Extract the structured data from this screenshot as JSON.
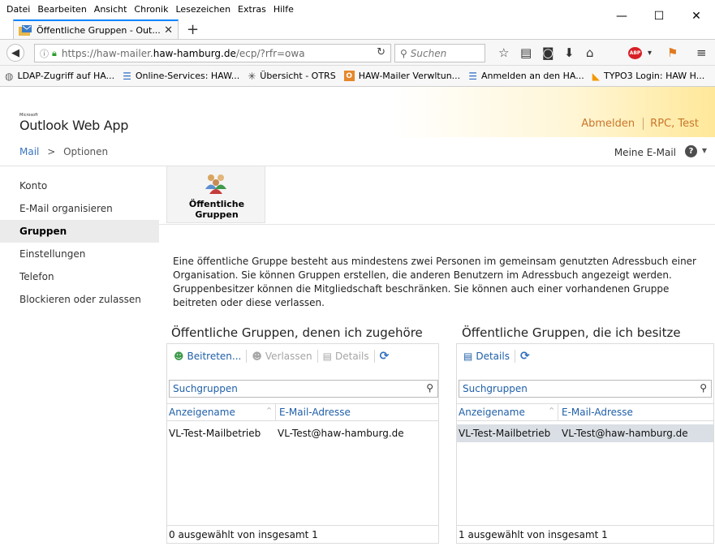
{
  "browser": {
    "menu": [
      "Datei",
      "Bearbeiten",
      "Ansicht",
      "Chronik",
      "Lesezeichen",
      "Extras",
      "Hilfe"
    ],
    "window_controls": {
      "minimize": "—",
      "maximize": "☐",
      "close": "✕"
    },
    "tab": {
      "title": "Öffentliche Gruppen - Out...",
      "close": "✕",
      "new_tab": "+"
    },
    "url": {
      "prefix": "https://haw-mailer.",
      "domain": "haw-hamburg.de",
      "path": "/ecp/?rfr=owa"
    },
    "search_placeholder": "Suchen",
    "bookmarks": [
      {
        "label": "LDAP-Zugriff auf HA...",
        "icon": "globe-icon"
      },
      {
        "label": "Online-Services: HAW...",
        "icon": "list-icon"
      },
      {
        "label": "Übersicht - OTRS",
        "icon": "otrs-icon"
      },
      {
        "label": "HAW-Mailer Verwltun...",
        "icon": "outlook-icon"
      },
      {
        "label": "Anmelden an den HA...",
        "icon": "list-icon"
      },
      {
        "label": "TYPO3 Login: HAW H...",
        "icon": "typo3-icon"
      }
    ],
    "colors": {
      "accent": "#0a84ff",
      "abp": "#d81f26"
    }
  },
  "owa": {
    "brand_small": "Microsoft",
    "title": "Outlook Web App",
    "signout": "Abmelden",
    "user": "RPC, Test",
    "breadcrumb": {
      "mail": "Mail",
      "separator": ">",
      "current": "Optionen"
    },
    "my_mail": "Meine E-Mail",
    "help": "?",
    "nav": [
      "Konto",
      "E-Mail organisieren",
      "Gruppen",
      "Einstellungen",
      "Telefon",
      "Blockieren oder zulassen"
    ],
    "nav_active": "Gruppen",
    "tile_label": "Öffentliche Gruppen",
    "description": "Eine öffentliche Gruppe besteht aus mindestens zwei Personen im gemeinsam genutzten Adressbuch einer Organisation. Sie können Gruppen erstellen, die anderen Benutzern im Adressbuch angezeigt werden. Gruppenbesitzer können die Mitgliedschaft beschränken. Sie können auch einer vorhandenen Gruppe beitreten oder diese verlassen.",
    "left_panel": {
      "title": "Öffentliche Gruppen, denen ich zugehöre",
      "toolbar": {
        "join": "Beitreten...",
        "leave": "Verlassen",
        "details": "Details"
      },
      "search_placeholder": "Suchgruppen",
      "col_name": "Anzeigename",
      "col_email": "E-Mail-Adresse",
      "rows": [
        {
          "name": "VL-Test-Mailbetrieb",
          "email": "VL-Test@haw-hamburg.de"
        }
      ],
      "footer": "0 ausgewählt von insgesamt 1"
    },
    "right_panel": {
      "title": "Öffentliche Gruppen, die ich besitze",
      "toolbar": {
        "details": "Details"
      },
      "search_placeholder": "Suchgruppen",
      "col_name": "Anzeigename",
      "col_email": "E-Mail-Adresse",
      "rows": [
        {
          "name": "VL-Test-Mailbetrieb",
          "email": "VL-Test@haw-hamburg.de"
        }
      ],
      "footer": "1 ausgewählt von insgesamt 1"
    },
    "colors": {
      "link": "#1f5fa8",
      "header_accent": "#c9762a",
      "selected_row": "#dadfe5"
    }
  }
}
